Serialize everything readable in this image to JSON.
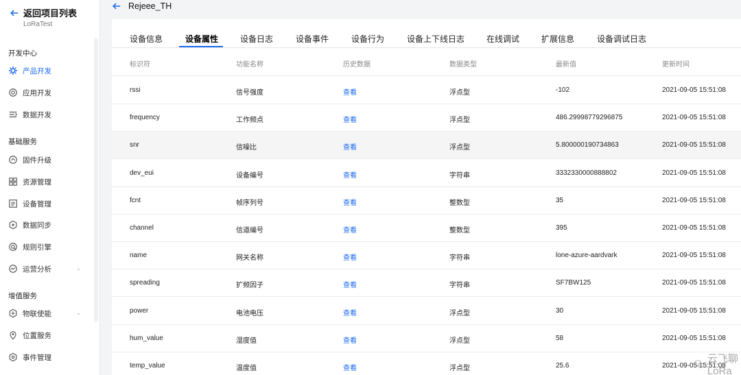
{
  "sidebar": {
    "back_label": "返回项目列表",
    "project_name": "LoRaTest",
    "sections": [
      {
        "title": "开发中心"
      },
      {
        "title": "基础服务"
      },
      {
        "title": "增值服务"
      }
    ],
    "items": [
      {
        "label": "产品开发",
        "icon": "product-dev-icon"
      },
      {
        "label": "应用开发",
        "icon": "app-dev-icon"
      },
      {
        "label": "数据开发",
        "icon": "data-dev-icon"
      },
      {
        "label": "固件升级",
        "icon": "firmware-icon"
      },
      {
        "label": "资源管理",
        "icon": "resource-icon"
      },
      {
        "label": "设备管理",
        "icon": "device-icon"
      },
      {
        "label": "数据同步",
        "icon": "sync-icon"
      },
      {
        "label": "规则引擎",
        "icon": "rules-icon"
      },
      {
        "label": "运营分析",
        "icon": "analytics-icon"
      },
      {
        "label": "物联使能",
        "icon": "iot-enable-icon"
      },
      {
        "label": "位置服务",
        "icon": "location-icon"
      },
      {
        "label": "事件管理",
        "icon": "event-icon"
      }
    ]
  },
  "header": {
    "device_name": "Rejeee_TH"
  },
  "tabs": [
    {
      "label": "设备信息"
    },
    {
      "label": "设备属性"
    },
    {
      "label": "设备日志"
    },
    {
      "label": "设备事件"
    },
    {
      "label": "设备行为"
    },
    {
      "label": "设备上下线日志"
    },
    {
      "label": "在线调试"
    },
    {
      "label": "扩展信息"
    },
    {
      "label": "设备调试日志"
    }
  ],
  "table": {
    "columns": [
      "标识符",
      "功能名称",
      "历史数据",
      "数据类型",
      "最新值",
      "更新时间"
    ],
    "rows": [
      {
        "id": "rssi",
        "name": "信号强度",
        "history": "查看",
        "type": "浮点型",
        "value": "-102",
        "time": "2021-09-05 15:51:08"
      },
      {
        "id": "frequency",
        "name": "工作频点",
        "history": "查看",
        "type": "浮点型",
        "value": "486.29998779296875",
        "time": "2021-09-05 15:51:08"
      },
      {
        "id": "snr",
        "name": "信噪比",
        "history": "查看",
        "type": "浮点型",
        "value": "5.800000190734863",
        "time": "2021-09-05 15:51:08"
      },
      {
        "id": "dev_eui",
        "name": "设备编号",
        "history": "查看",
        "type": "字符串",
        "value": "3332330000888802",
        "time": "2021-09-05 15:51:08"
      },
      {
        "id": "fcnt",
        "name": "帧序列号",
        "history": "查看",
        "type": "整数型",
        "value": "35",
        "time": "2021-09-05 15:51:08"
      },
      {
        "id": "channel",
        "name": "信道编号",
        "history": "查看",
        "type": "整数型",
        "value": "395",
        "time": "2021-09-05 15:51:08"
      },
      {
        "id": "name",
        "name": "网关名称",
        "history": "查看",
        "type": "字符串",
        "value": "lone-azure-aardvark",
        "time": "2021-09-05 15:51:08"
      },
      {
        "id": "spreading",
        "name": "扩频因子",
        "history": "查看",
        "type": "字符串",
        "value": "SF7BW125",
        "time": "2021-09-05 15:51:08"
      },
      {
        "id": "power",
        "name": "电池电压",
        "history": "查看",
        "type": "浮点型",
        "value": "30",
        "time": "2021-09-05 15:51:08"
      },
      {
        "id": "hum_value",
        "name": "湿度值",
        "history": "查看",
        "type": "浮点型",
        "value": "58",
        "time": "2021-09-05 15:51:08"
      },
      {
        "id": "temp_value",
        "name": "温度值",
        "history": "查看",
        "type": "浮点型",
        "value": "25.6",
        "time": "2021-09-05 15:51:08"
      }
    ]
  },
  "watermark": {
    "text": "云飞聊LoRa"
  },
  "colors": {
    "accent": "#1a6af0",
    "highlight_row": "#f5f5f5"
  }
}
